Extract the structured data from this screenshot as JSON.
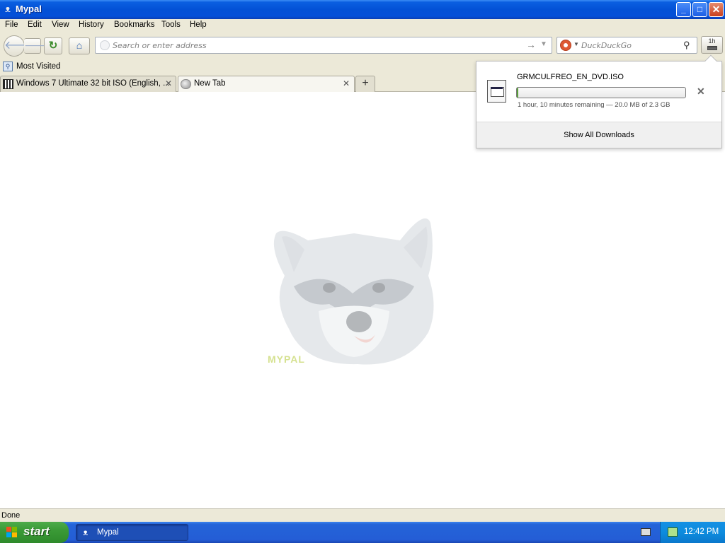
{
  "window": {
    "title": "Mypal",
    "app_icon": "raccoon-icon",
    "controls": {
      "minimize": "_",
      "maximize": "□",
      "close": "✕"
    }
  },
  "menu": [
    "File",
    "Edit",
    "View",
    "History",
    "Bookmarks",
    "Tools",
    "Help"
  ],
  "navbar": {
    "back_icon": "back-arrow-icon",
    "forward_icon": "forward-arrow-icon",
    "reload_icon": "reload-icon",
    "home_icon": "home-icon",
    "url_placeholder": "Search or enter address",
    "url_value": "",
    "search_engine_icon": "duckduckgo-icon",
    "search_placeholder": "DuckDuckGo",
    "search_value": "",
    "downloads_time": "1h"
  },
  "bookmarks": {
    "most_visited": "Most Visited"
  },
  "tabs": [
    {
      "label": "Windows 7 Ultimate 32 bit ISO (English, ...",
      "active": false,
      "icon": "archive-icon"
    },
    {
      "label": "New Tab",
      "active": true,
      "icon": "globe-icon"
    }
  ],
  "content": {
    "logo_text": "MYPAL"
  },
  "downloads_panel": {
    "filename": "GRMCULFREO_EN_DVD.ISO",
    "progress": 0.0087,
    "status": "1 hour, 10 minutes remaining — 20.0 MB of 2.3 GB",
    "show_all": "Show All Downloads"
  },
  "statusbar": {
    "text": "Done"
  },
  "taskbar": {
    "start": "start",
    "task": "Mypal",
    "clock": "12:42 PM"
  },
  "colors": {
    "titlebar": "#0351d6",
    "chrome": "#ece9d8",
    "taskbar": "#245dd6",
    "start_button": "#3a9a36",
    "progress_fill": "#5aa13b"
  }
}
